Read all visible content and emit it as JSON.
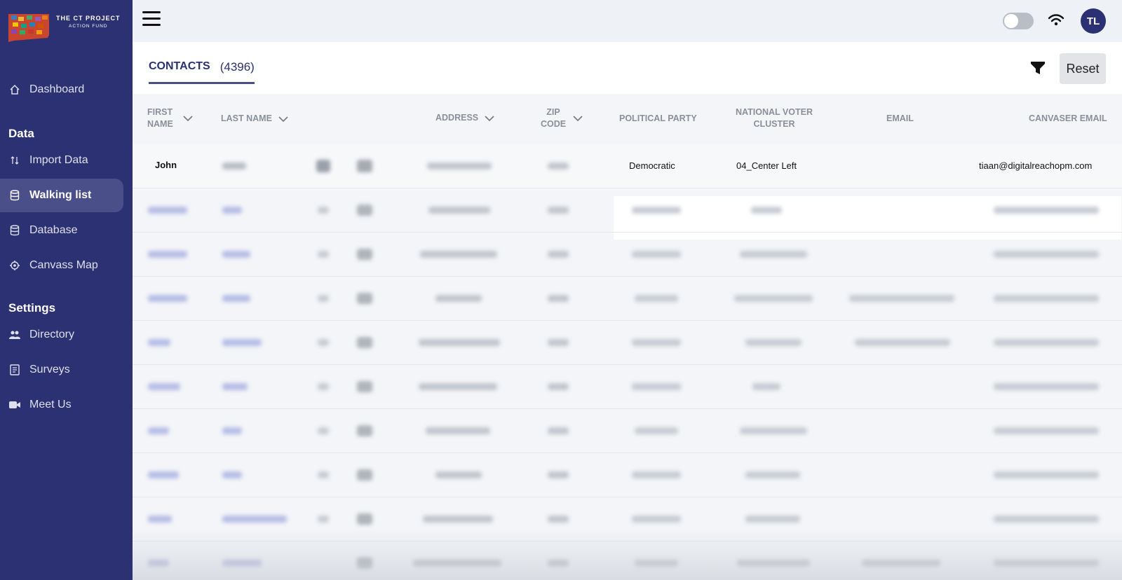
{
  "logo": {
    "line1": "THE CT PROJECT",
    "line2": "ACTION FUND"
  },
  "nav": {
    "dashboard": "Dashboard",
    "section_data": "Data",
    "import_data": "Import Data",
    "walking_list": "Walking list",
    "database": "Database",
    "canvass_map": "Canvass Map",
    "section_settings": "Settings",
    "directory": "Directory",
    "surveys": "Surveys",
    "meet_us": "Meet Us"
  },
  "topbar": {
    "avatar_initials": "TL"
  },
  "header": {
    "tab_label": "CONTACTS",
    "tab_count": "(4396)",
    "reset_label": "Reset"
  },
  "table": {
    "columns": {
      "first_name": "FIRST NAME",
      "last_name": "LAST NAME",
      "address": "ADDRESS",
      "zip_code": "ZIP CODE",
      "political_party": "POLITICAL PARTY",
      "national_voter_cluster": "NATIONAL VOTER CLUSTER",
      "email": "EMAIL",
      "canvaser_email": "CANVASER EMAIL"
    },
    "first_row": {
      "first_name": "John",
      "political_party": "Democratic",
      "national_voter_cluster": "04_Center Left",
      "canvaser_email": "tiaan@digitalreachopm.com"
    }
  },
  "colors": {
    "sidebar": "#2b3172",
    "accent": "#4a4f8a"
  }
}
